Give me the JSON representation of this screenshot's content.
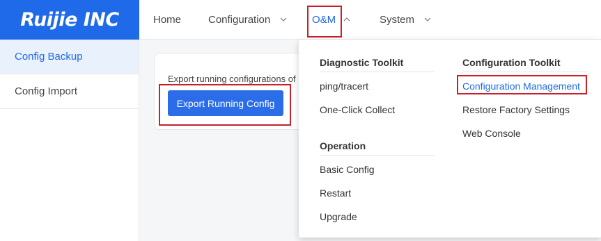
{
  "brand": {
    "logo_text": "Ruijie INC",
    "header_color": "#1e6ae8"
  },
  "topnav": {
    "items": [
      {
        "label": "Home",
        "has_dropdown": false,
        "active": false
      },
      {
        "label": "Configuration",
        "has_dropdown": true,
        "active": false
      },
      {
        "label": "O&M",
        "has_dropdown": true,
        "active": true,
        "expanded": true
      },
      {
        "label": "System",
        "has_dropdown": true,
        "active": false
      }
    ]
  },
  "sidebar": {
    "items": [
      {
        "label": "Config Backup",
        "active": true
      },
      {
        "label": "Config Import",
        "active": false
      }
    ]
  },
  "main": {
    "description": "Export running configurations of",
    "export_button_label": "Export Running Config"
  },
  "dropdown": {
    "diagnostic_heading": "Diagnostic Toolkit",
    "diagnostic_items": [
      "ping/tracert",
      "One-Click Collect"
    ],
    "operation_heading": "Operation",
    "operation_items": [
      "Basic Config",
      "Restart",
      "Upgrade"
    ],
    "config_heading": "Configuration Toolkit",
    "config_items": [
      "Configuration Management",
      "Restore Factory Settings",
      "Web Console"
    ]
  },
  "colors": {
    "accent": "#1e6ae8",
    "highlight_border": "#c8202a",
    "sidebar_active_bg": "#e9f1fd"
  },
  "icons": {
    "dropdown_chevron": "chevron-down-icon",
    "expanded_chevron": "chevron-up-icon"
  }
}
